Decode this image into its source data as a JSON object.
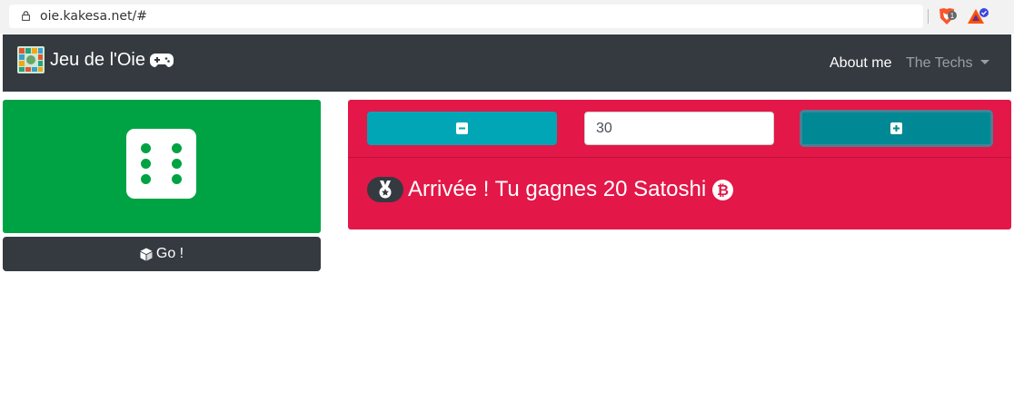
{
  "browser": {
    "url": "oie.kakesa.net/#",
    "icons": [
      "lock-icon",
      "brave-shield-icon",
      "bat-rewards-icon"
    ],
    "brave_badge": "1"
  },
  "navbar": {
    "brand": "Jeu de l'Oie",
    "brand_icons": [
      "game-board-logo",
      "gamepad-icon"
    ],
    "links": [
      {
        "label": "About me",
        "active": true
      },
      {
        "label": "The Techs",
        "dropdown": true
      }
    ]
  },
  "dice": {
    "value": 6,
    "icon": "dice-six-icon",
    "card_color": "#00a344"
  },
  "go_button": {
    "label": "Go !",
    "icon": "cube-icon"
  },
  "controls": {
    "minus_icon": "minus-square-icon",
    "plus_icon": "plus-square-icon",
    "quantity_value": "30"
  },
  "result": {
    "icon": "medal-icon",
    "text": "Arrivée ! Tu gagnes 20 Satoshi",
    "currency_icon": "bitcoin-icon"
  },
  "colors": {
    "navbar": "#343a40",
    "panel": "#e31748",
    "dice_card": "#00a344",
    "minus_button": "#00a6b5",
    "plus_button": "#008994"
  }
}
